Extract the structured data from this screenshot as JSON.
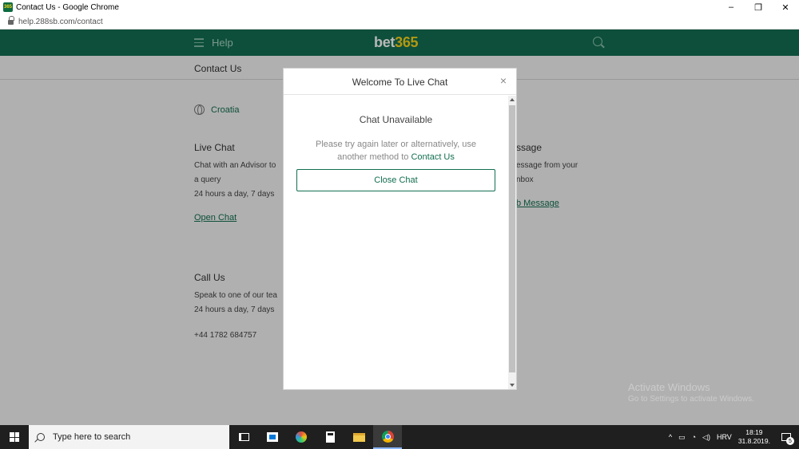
{
  "window": {
    "title": "Contact Us - Google Chrome",
    "controls": {
      "minimize": "–",
      "maximize": "❐",
      "close": "✕"
    }
  },
  "browser": {
    "url": "help.288sb.com/contact"
  },
  "header": {
    "menu_label": "Help",
    "logo_part1": "bet",
    "logo_part2": "365",
    "brand_color": "#126e51",
    "accent_color": "#f7d31a"
  },
  "page": {
    "subheader_title": "Contact Us",
    "country": "Croatia",
    "live_chat": {
      "title": "Live Chat",
      "line1": "Chat with an Advisor to",
      "line2": "a query",
      "hours": "24 hours a day, 7 days",
      "link": "Open Chat"
    },
    "message": {
      "title": "ssage",
      "line1": "essage from your",
      "line2": "nbox",
      "link": "b Message"
    },
    "call": {
      "title": "Call Us",
      "line1": "Speak to one of our tea",
      "hours": "24 hours a day, 7 days",
      "phone": "+44 1782 684757"
    }
  },
  "modal": {
    "title": "Welcome To Live Chat",
    "close_glyph": "×",
    "heading": "Chat Unavailable",
    "message": "Please try again later or alternatively, use another method to",
    "message_link": "Contact Us",
    "button": "Close Chat"
  },
  "watermark": {
    "line1": "Activate Windows",
    "line2": "Go to Settings to activate Windows."
  },
  "taskbar": {
    "search_placeholder": "Type here to search",
    "language": "HRV",
    "time": "18:19",
    "date": "31.8.2019.",
    "notification_count": "5",
    "tray_chevron": "^"
  }
}
